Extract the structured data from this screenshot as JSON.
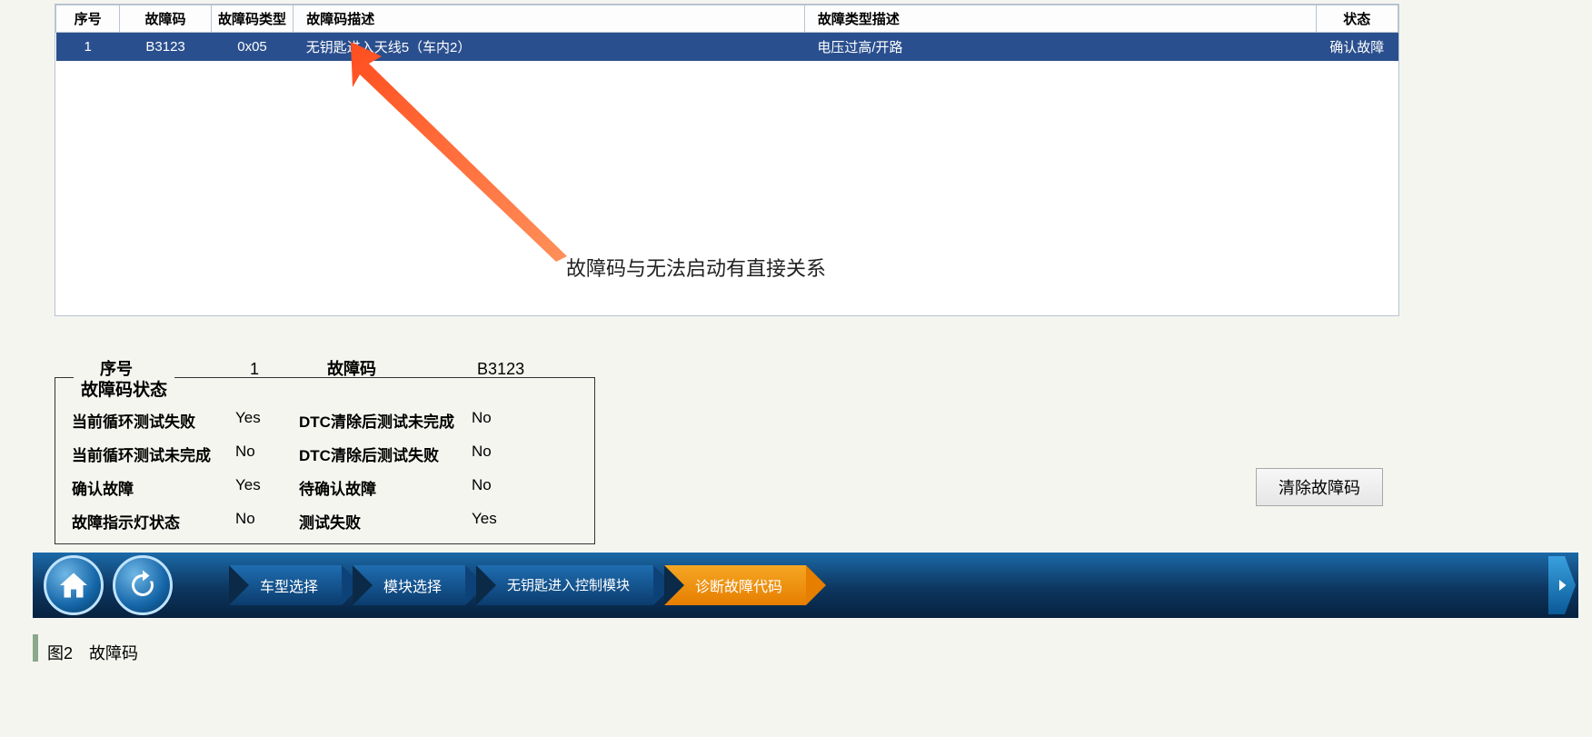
{
  "table": {
    "headers": {
      "seq": "序号",
      "code": "故障码",
      "code_type": "故障码类型",
      "code_desc": "故障码描述",
      "type_desc": "故障类型描述",
      "status": "状态"
    },
    "row": {
      "seq": "1",
      "code": "B3123",
      "code_type": "0x05",
      "code_desc": "无钥匙进入天线5（车内2）",
      "type_desc": "电压过高/开路",
      "status": "确认故障"
    }
  },
  "annotation": "故障码与无法启动有直接关系",
  "mid": {
    "seq_label": "序号",
    "seq_value": "1",
    "code_label": "故障码",
    "code_value": "B3123"
  },
  "status_group": {
    "title": "故障码状态",
    "rows": [
      {
        "l1": "当前循环测试失败",
        "v1": "Yes",
        "l2": "DTC清除后测试未完成",
        "v2": "No"
      },
      {
        "l1": "当前循环测试未完成",
        "v1": "No",
        "l2": "DTC清除后测试失败",
        "v2": "No"
      },
      {
        "l1": "确认故障",
        "v1": "Yes",
        "l2": "待确认故障",
        "v2": "No"
      },
      {
        "l1": "故障指示灯状态",
        "v1": "No",
        "l2": "测试失败",
        "v2": "Yes"
      }
    ]
  },
  "buttons": {
    "clear": "清除故障码"
  },
  "breadcrumb": {
    "b1": "车型选择",
    "b2": "模块选择",
    "b3": "无钥匙进入控制模块",
    "b4": "诊断故障代码"
  },
  "caption": "图2　故障码"
}
